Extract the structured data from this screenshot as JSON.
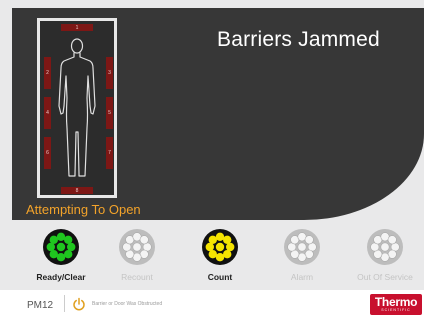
{
  "status": {
    "title": "Barriers Jammed",
    "message": "Attempting To Open"
  },
  "zones": [
    {
      "id": "1",
      "label": "1"
    },
    {
      "id": "2",
      "label": "2"
    },
    {
      "id": "3",
      "label": "3"
    },
    {
      "id": "4",
      "label": "4"
    },
    {
      "id": "5",
      "label": "5"
    },
    {
      "id": "6",
      "label": "6"
    },
    {
      "id": "7",
      "label": "7"
    },
    {
      "id": "8",
      "label": "8"
    }
  ],
  "indicators": [
    {
      "label": "Ready/Clear",
      "state": "on",
      "color": "#1fc61f"
    },
    {
      "label": "Recount",
      "state": "off",
      "color": "#d9d9d9"
    },
    {
      "label": "Count",
      "state": "on",
      "color": "#f5e400"
    },
    {
      "label": "Alarm",
      "state": "off",
      "color": "#d9d9d9"
    },
    {
      "label": "Out Of Service",
      "state": "off",
      "color": "#d9d9d9"
    }
  ],
  "footer": {
    "terminal_id": "PM12",
    "note": "Barrier or Door Was Obstructed",
    "brand": "Thermo",
    "brand_sub": "SCIENTIFIC"
  },
  "colors": {
    "panel": "#373737",
    "message": "#f3a32a",
    "zone_bar": "#7d1715",
    "brand": "#c8102e"
  }
}
